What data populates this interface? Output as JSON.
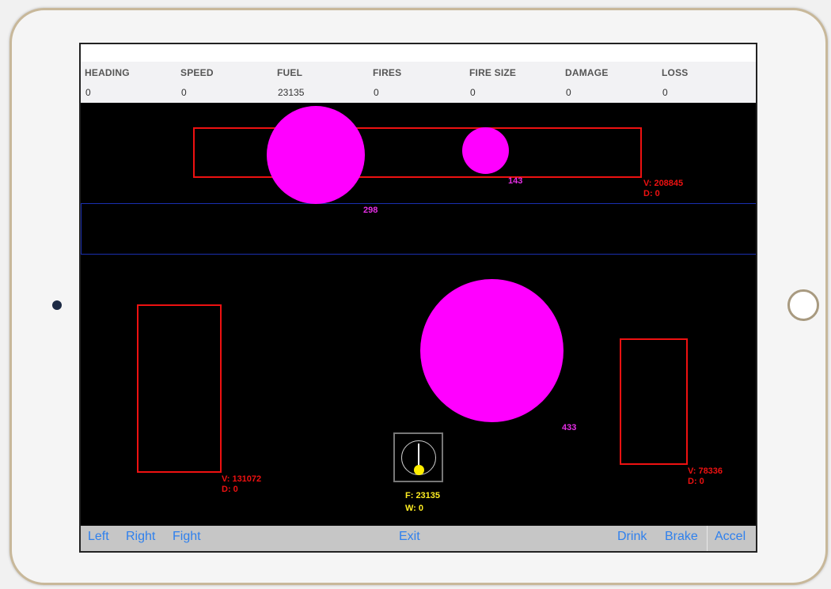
{
  "hud": [
    {
      "label": "HEADING",
      "value": "0"
    },
    {
      "label": "SPEED",
      "value": "0"
    },
    {
      "label": "FUEL",
      "value": "23135"
    },
    {
      "label": "FIRES",
      "value": "0"
    },
    {
      "label": "FIRE SIZE",
      "value": "0"
    },
    {
      "label": "DAMAGE",
      "value": "0"
    },
    {
      "label": "LOSS",
      "value": "0"
    }
  ],
  "fires": [
    {
      "label": "298"
    },
    {
      "label": "143"
    },
    {
      "label": "433"
    }
  ],
  "zones": [
    {
      "value_line": "V:  208845",
      "damage_line": "D: 0"
    },
    {
      "value_line": "V:  131072",
      "damage_line": "D: 0"
    },
    {
      "value_line": "V:  78336",
      "damage_line": "D: 0"
    }
  ],
  "truck": {
    "fuel_line": "F:  23135",
    "water_line": "W: 0"
  },
  "controls": {
    "left": "Left",
    "right": "Right",
    "fight": "Fight",
    "exit": "Exit",
    "drink": "Drink",
    "brake": "Brake",
    "accel": "Accel"
  },
  "colors": {
    "fire": "#ff00ff",
    "zone": "#e11111",
    "lane": "#1a2fb0",
    "truck": "#ffee00",
    "button": "#2f80ed"
  }
}
